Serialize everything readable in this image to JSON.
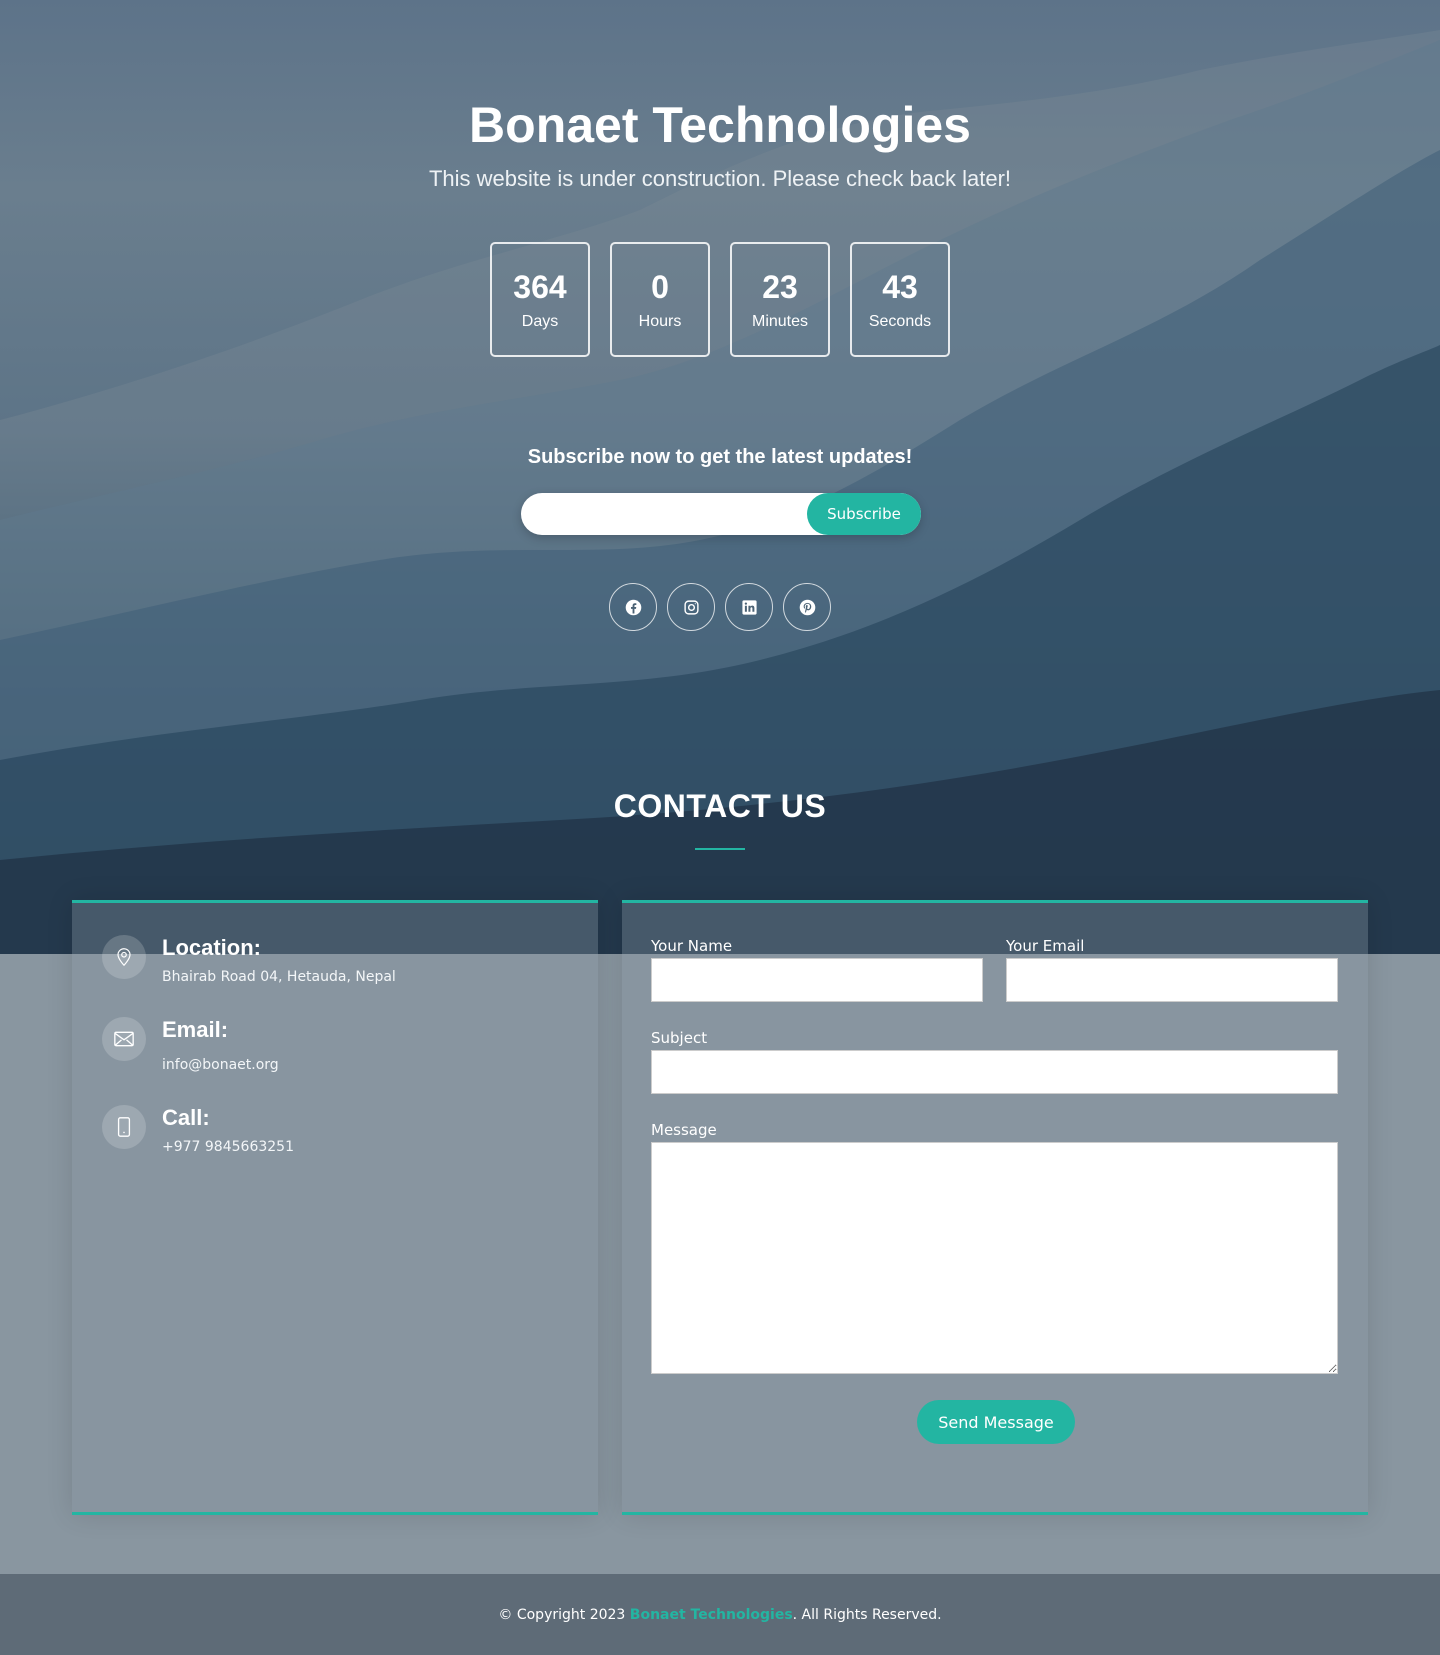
{
  "hero": {
    "title": "Bonaet Technologies",
    "subtitle": "This website is under construction. Please check back later!"
  },
  "countdown": [
    {
      "value": "364",
      "label": "Days"
    },
    {
      "value": "0",
      "label": "Hours"
    },
    {
      "value": "23",
      "label": "Minutes"
    },
    {
      "value": "43",
      "label": "Seconds"
    }
  ],
  "subscribe": {
    "heading": "Subscribe now to get the latest updates!",
    "input_value": "",
    "button_label": "Subscribe"
  },
  "socials": [
    "facebook-icon",
    "instagram-icon",
    "linkedin-icon",
    "pinterest-icon"
  ],
  "contact": {
    "title": "CONTACT US",
    "location_label": "Location:",
    "location_value": "Bhairab Road 04, Hetauda, Nepal",
    "email_label": "Email:",
    "email_value": "info@bonaet.org",
    "call_label": "Call:",
    "call_value": "+977 9845663251"
  },
  "form": {
    "name_label": "Your Name",
    "email_label": "Your Email",
    "subject_label": "Subject",
    "message_label": "Message",
    "name_value": "",
    "email_value": "",
    "subject_value": "",
    "message_value": "",
    "send_label": "Send Message"
  },
  "footer": {
    "prefix": "© Copyright 2023",
    "brand": "Bonaet Technologies",
    "suffix": ". All Rights Reserved."
  },
  "colors": {
    "accent": "#23b5a2",
    "footer_bg": "#5e6b77",
    "lower_bg": "#8996a0"
  }
}
